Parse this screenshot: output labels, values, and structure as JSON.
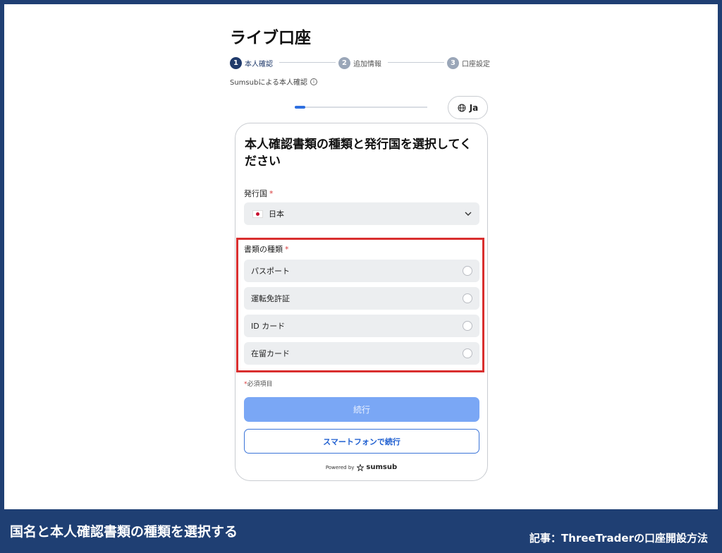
{
  "page": {
    "title": "ライブ口座",
    "steps": [
      {
        "num": "1",
        "label": "本人確認"
      },
      {
        "num": "2",
        "label": "追加情報"
      },
      {
        "num": "3",
        "label": "口座設定"
      }
    ],
    "sumsub_text": "Sumsubによる本人確認",
    "progress": 0.08,
    "language": "Ja"
  },
  "card": {
    "title": "本人確認書類の種類と発行国を選択してください",
    "country_label": "発行国",
    "required_mark": "*",
    "country_value": "日本",
    "doc_type_label": "書類の種類",
    "doc_types": [
      {
        "label": "パスポート"
      },
      {
        "label": "運転免許証"
      },
      {
        "label": "ID カード"
      },
      {
        "label": "在留カード"
      }
    ],
    "required_note_mark": "*",
    "required_note": "必須項目",
    "continue_label": "続行",
    "phone_continue_label": "スマートフォンで続行",
    "powered_by": "Powered by",
    "powered_brand": "sumsub"
  },
  "footer": {
    "caption": "国名と本人確認書類の種類を選択する",
    "article": "記事：ThreeTraderの口座開設方法"
  },
  "colors": {
    "frame": "#1f3f73",
    "highlight": "#d92f2f",
    "primary_button": "#7aa7f5",
    "accent": "#2e6fe0"
  }
}
